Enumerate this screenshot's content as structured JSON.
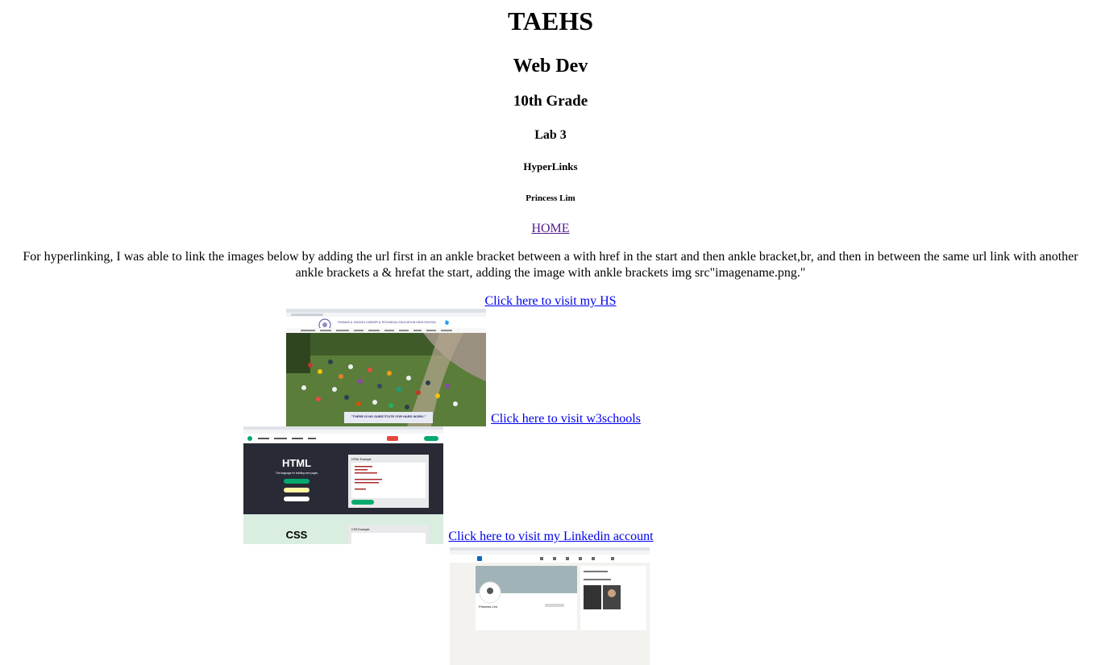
{
  "page": {
    "h1": "TAEHS",
    "h2": "Web Dev",
    "h3": "10th Grade",
    "h4": "Lab 3",
    "h5": "HyperLinks",
    "h6": "Princess Lim"
  },
  "nav": {
    "home_label": "HOME"
  },
  "description": "For hyperlinking, I was able to link the images below by adding the url first in an ankle bracket between a with href in the start and then ankle bracket,br, and then in between the same url link with another ankle brackets a & hrefat the start, adding the image with ankle brackets img src\"imagename.png.\"",
  "links": [
    {
      "label": "Click here to visit my HS"
    },
    {
      "label": "Click here to visit w3schools"
    },
    {
      "label": "Click here to visit my Linkedin account"
    }
  ],
  "screenshots": {
    "hs": {
      "banner": "THOMAS A. EDISON CAREER & TECHNICAL EDUCATION HIGH SCHOOL",
      "quote": "\"THERE IS NO SUBSTITUTE FOR HARD WORK.\""
    },
    "w3": {
      "html_heading": "HTML",
      "html_sub": "The language for building web pages",
      "example_heading": "HTML Example",
      "css_heading": "CSS",
      "css_example_heading": "CSS Example"
    },
    "linkedin": {
      "profile_name": "Princess Lim"
    }
  },
  "colors": {
    "link": "#0000ee",
    "visited": "#551a8b",
    "w3_dark": "#282a35",
    "w3_green": "#04aa6d",
    "w3_mint": "#d9eee1",
    "linkedin_blue": "#0a66c2"
  }
}
